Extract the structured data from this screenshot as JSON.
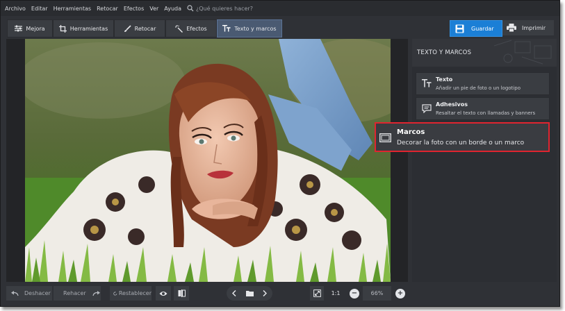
{
  "menu": {
    "items": [
      "Archivo",
      "Editar",
      "Herramientas",
      "Retocar",
      "Efectos",
      "Ver",
      "Ayuda"
    ],
    "search_placeholder": "¿Qué quieres hacer?"
  },
  "tabs": [
    {
      "label": "Mejora",
      "icon": "sliders-icon"
    },
    {
      "label": "Herramientas",
      "icon": "crop-icon"
    },
    {
      "label": "Retocar",
      "icon": "brush-icon"
    },
    {
      "label": "Efectos",
      "icon": "magic-wand-icon"
    },
    {
      "label": "Texto y marcos",
      "icon": "text-icon",
      "active": true
    }
  ],
  "actions": {
    "save": "Guardar",
    "print": "Imprimir"
  },
  "panel": {
    "title": "TEXTO Y MARCOS",
    "items": [
      {
        "title": "Texto",
        "desc": "Añadir un pie de foto o un logotipo",
        "icon": "text-icon"
      },
      {
        "title": "Adhesivos",
        "desc": "Resaltar el texto con llamadas y banners",
        "icon": "speech-bubble-icon"
      },
      {
        "title": "Marcos",
        "desc": "Decorar la foto con un borde o un marco",
        "icon": "frame-icon",
        "highlighted": true
      }
    ]
  },
  "bottom": {
    "undo": "Deshacer",
    "redo": "Rehacer",
    "reset": "Restablecer",
    "actual_size": "1:1",
    "zoom": "66%"
  },
  "colors": {
    "accent": "#1b7fd6",
    "highlight_border": "#e0242f",
    "background": "#2f3136"
  }
}
